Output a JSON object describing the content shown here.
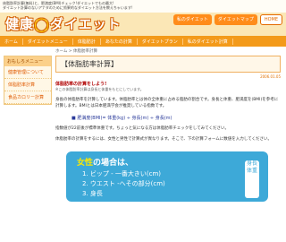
{
  "topbar": {
    "line1": "体脂肪率計算(無料)と、肥満度(BMI)チェック!ダイエットでもの最大!",
    "line2": "ダイエット計算のないアナタのために効果的なダイエット方法を教えちゃいます!"
  },
  "header": {
    "logo_left": "健康",
    "logo_mark": "◯",
    "logo_right": "ダイエット",
    "links": [
      "私のダイエット",
      "ダイエットマップ"
    ],
    "home": "HOME"
  },
  "nav": [
    "ホーム",
    "ダイエットメニュー",
    "体脂肪計",
    "あなたの計算",
    "ダイエットプラン",
    "私のダイエット計算"
  ],
  "crumb": "ホーム > 体脂肪率計算",
  "sidebar": {
    "heading": "おもしろメニュー",
    "items": [
      "健康管理について",
      "体脂肪率計算",
      "食品カロリー計算"
    ]
  },
  "main": {
    "title": "【体脂肪率計算】",
    "date": "2006.01.05",
    "lead": "体脂肪率の計算をしよう!",
    "note": "※この体脂肪率計算は身長と体重をもとにしています。",
    "p1": "身長の体脂肪率を計算しています。体脂肪率とは体の全体重に占める脂肪の割合です。身長と体重、肥満度を(BMI)を参考に計算します。BMIとは日本肥満学会が推奨している指数です。",
    "formula": "■ 肥満度(BMI)= 体重(kg) ÷ 身長(m) ÷ 身長(m)",
    "p2": "指数値が22前後が標準体重です。ちょっと気になる方は体脂肪率チェックをしてみてください。",
    "p3": "体脂肪率の計算をするには、女性と男性で計算式が異なります。そこで、下の計算フォームに数値を入力してください。"
  },
  "calc_box": {
    "title_a": "女性",
    "title_b": "の場合は、",
    "rows": [
      "1. ビップ - 一番大きい(cm)",
      "2. ウエスト -へその部分(cm)",
      "3. 身長"
    ],
    "aside": "身長体重"
  }
}
